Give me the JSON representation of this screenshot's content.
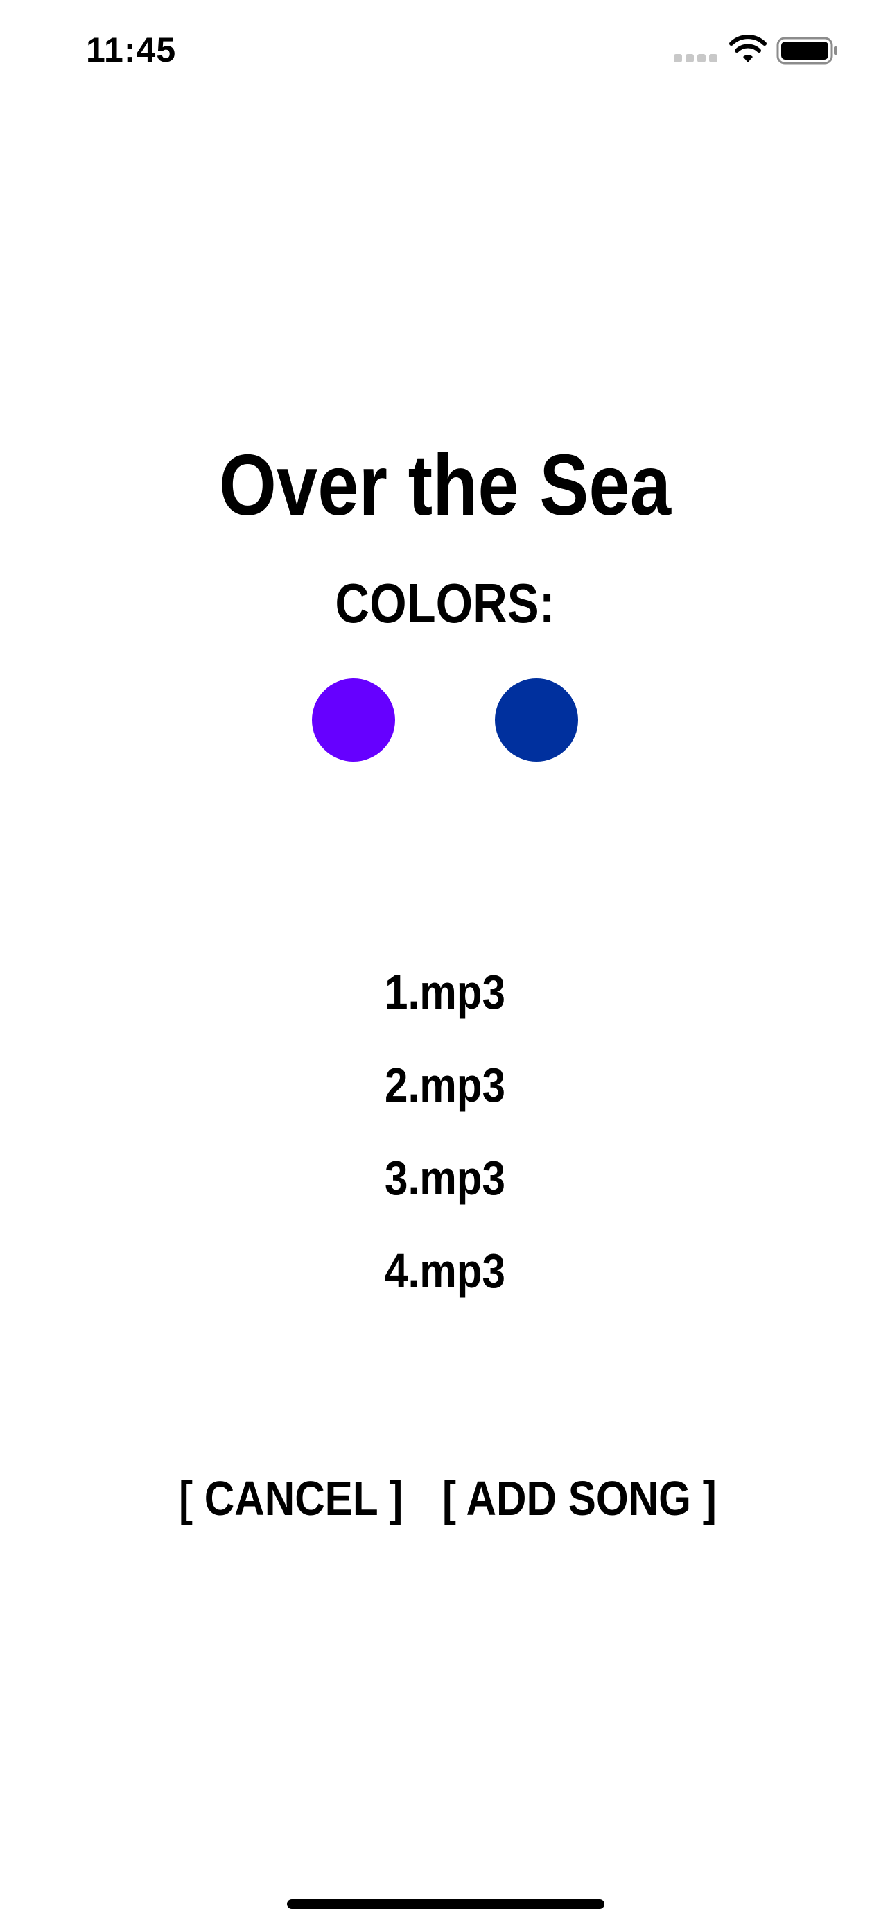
{
  "status_bar": {
    "time": "11:45",
    "icons": [
      "cellular-signal-icon",
      "wifi-icon",
      "battery-icon"
    ]
  },
  "title": "Over the Sea",
  "colors": {
    "label": "COLORS:",
    "swatches": [
      "#6600FF",
      "#00309E"
    ]
  },
  "songs": [
    "1.mp3",
    "2.mp3",
    "3.mp3",
    "4.mp3"
  ],
  "buttons": {
    "cancel_label": "[ CANCEL ]",
    "add_song_label": "[ ADD SONG ]"
  }
}
